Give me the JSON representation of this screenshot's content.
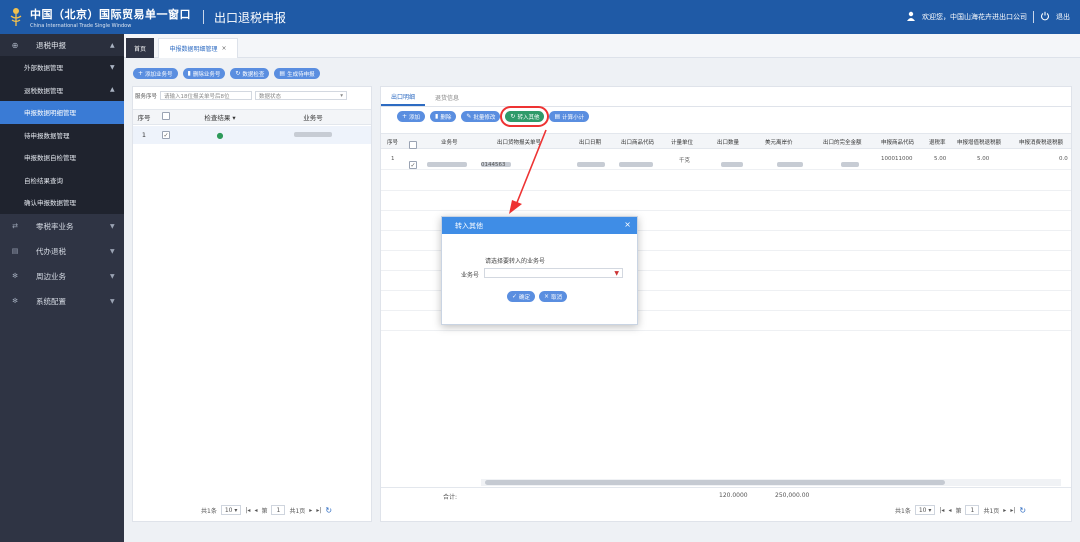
{
  "header": {
    "brand_cn": "中国（北京）国际贸易单一窗口",
    "brand_en": "China International Trade Single Window",
    "module": "出口退税申报",
    "welcome": "欢迎您，中国山海花卉进出口公司",
    "logout": "退出"
  },
  "sidebar": {
    "top": {
      "label": "退税申报"
    },
    "subitems": [
      {
        "label": "外部数据管理"
      },
      {
        "label": "退税数据管理"
      },
      {
        "label": "申报数据明细管理"
      },
      {
        "label": "待申报数据管理"
      },
      {
        "label": "申报数据自检管理"
      },
      {
        "label": "自检结果查询"
      },
      {
        "label": "确认申报数据管理"
      }
    ],
    "groups": [
      {
        "label": "零税率业务"
      },
      {
        "label": "代办退税"
      },
      {
        "label": "周边业务"
      },
      {
        "label": "系统配置"
      }
    ]
  },
  "tabs": {
    "home": "首页",
    "active": "申报数据明细管理"
  },
  "toolbar": {
    "add_biz": "添加业务号",
    "del_biz": "删除业务号",
    "data_check": "数据检查",
    "gen_declare": "生成待申报"
  },
  "left": {
    "filter_label": "服务序号",
    "filter_placeholder": "请输入18位报关单号后8位",
    "status_placeholder": "数据状态",
    "columns": {
      "seq": "序号",
      "check": "检查结果",
      "biz": "业务号"
    },
    "row": {
      "seq": "1"
    },
    "pager": {
      "total": "共1条",
      "size": "10",
      "page_label": "第",
      "page": "1",
      "pages": "共1页"
    }
  },
  "right": {
    "tabs": [
      "出口明细",
      "退货信息"
    ],
    "buttons": {
      "add": "添加",
      "delete": "删除",
      "batch_modify": "批量修改",
      "transfer": "转入其他",
      "calc": "计算小计"
    },
    "columns": [
      "序号",
      "业务号",
      "出口货物报关单号",
      "出口日期",
      "出口商品代码",
      "计量单位",
      "出口数量",
      "美元离岸价",
      "出口的完全金额",
      "申报商品代码",
      "退税率",
      "申报增值税退税额",
      "申报消费税退税额"
    ],
    "row": {
      "seq": "1",
      "decl_no": "0144563",
      "unit": "千克",
      "code": "100011000",
      "rate": "5.00",
      "vat": "5.00",
      "consump": "0.0"
    },
    "summary": {
      "label": "合计:",
      "qty": "120.0000",
      "fob": "250,000.00"
    },
    "pager": {
      "total": "共1条",
      "size": "10",
      "page_label": "第",
      "page": "1",
      "pages": "共1页"
    }
  },
  "modal": {
    "title": "转入其他",
    "message": "请选择要转入的业务号",
    "field_label": "业务号",
    "ok": "确定",
    "cancel": "取消"
  }
}
